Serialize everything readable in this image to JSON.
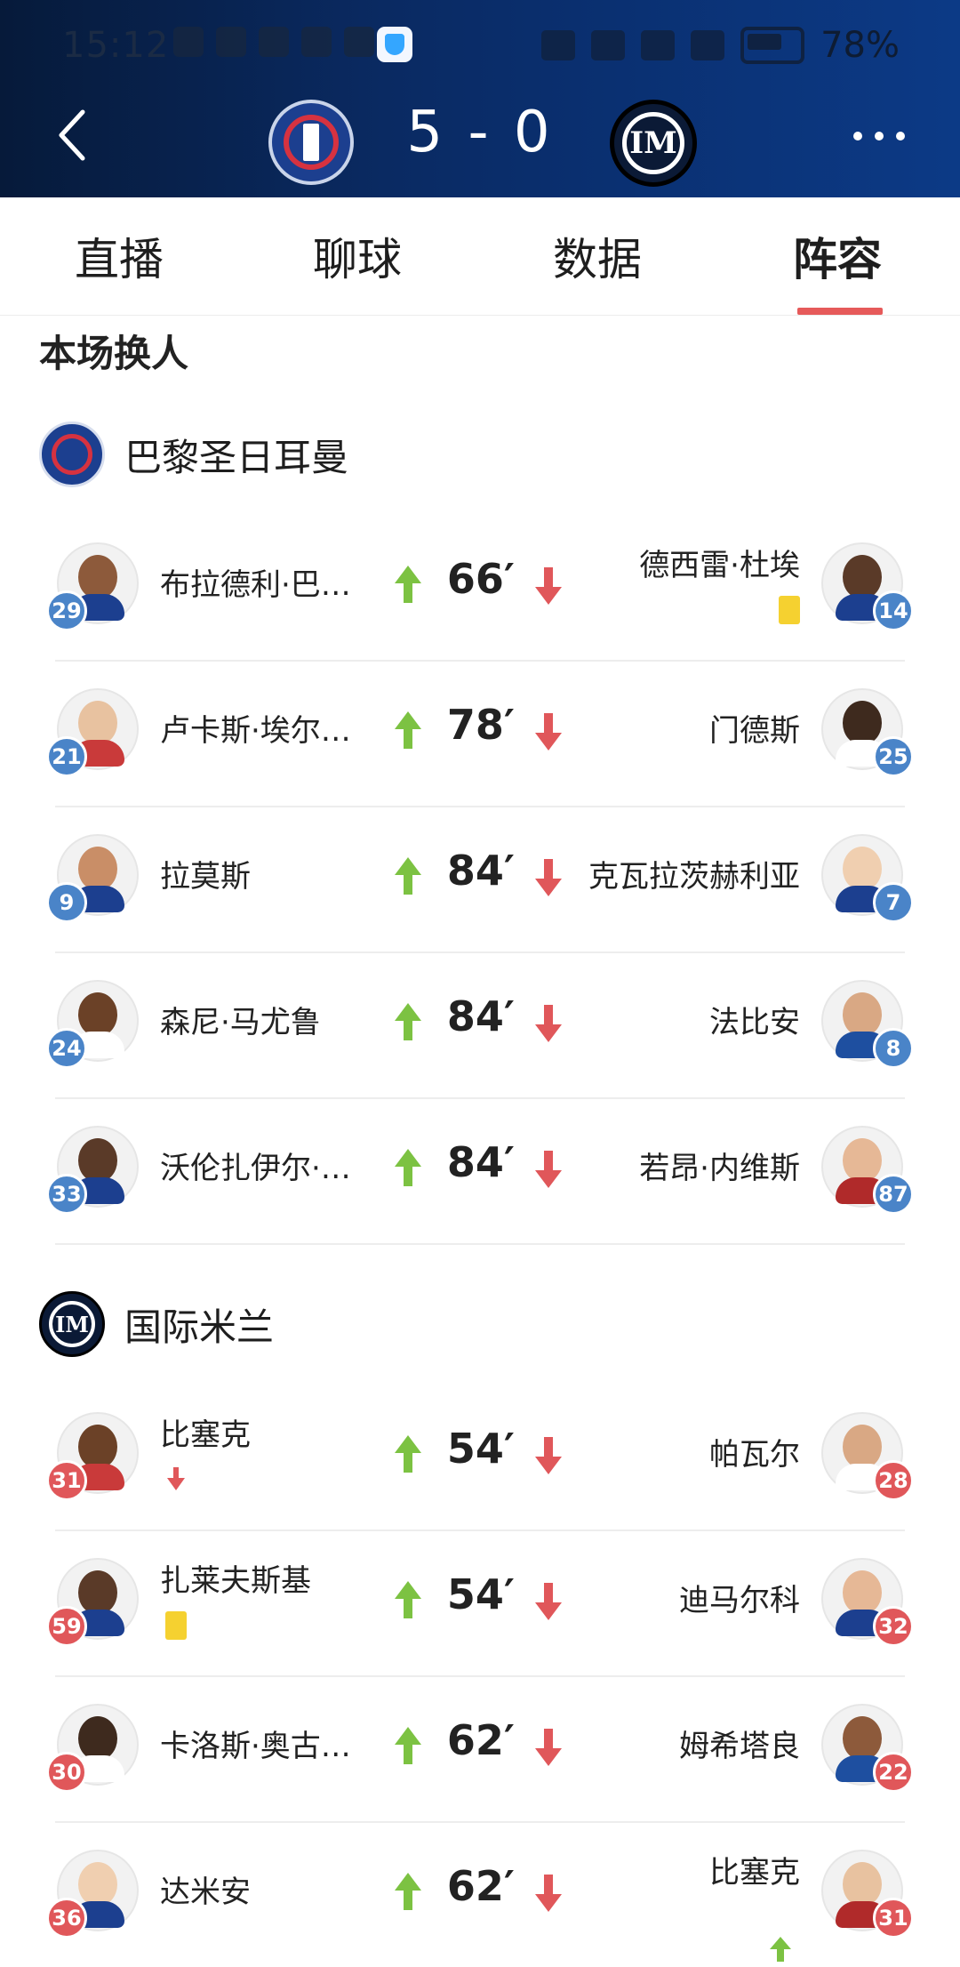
{
  "status_bar": {
    "time": "15:12",
    "battery": "78%"
  },
  "match": {
    "score": "5 - 0"
  },
  "tabs": [
    "直播",
    "聊球",
    "数据",
    "阵容"
  ],
  "active_tab": "阵容",
  "section_title": "本场换人",
  "teams": [
    {
      "name": "巴黎圣日耳曼",
      "badge_color": "#4a84c8",
      "subs": [
        {
          "in": "布拉德利·巴…",
          "in_no": "29",
          "minute": "66′",
          "out": "德西雷·杜埃",
          "out_no": "14",
          "out_card": true
        },
        {
          "in": "卢卡斯·埃尔…",
          "in_no": "21",
          "minute": "78′",
          "out": "门德斯",
          "out_no": "25"
        },
        {
          "in": "拉莫斯",
          "in_no": "9",
          "minute": "84′",
          "out": "克瓦拉茨赫利亚",
          "out_no": "7"
        },
        {
          "in": "森尼·马尤鲁",
          "in_no": "24",
          "minute": "84′",
          "out": "法比安",
          "out_no": "8"
        },
        {
          "in": "沃伦扎伊尔·…",
          "in_no": "33",
          "minute": "84′",
          "out": "若昂·内维斯",
          "out_no": "87"
        }
      ]
    },
    {
      "name": "国际米兰",
      "badge_color": "#e0575a",
      "subs": [
        {
          "in": "比塞克",
          "in_no": "31",
          "minute": "54′",
          "out": "帕瓦尔",
          "out_no": "28",
          "in_down_arrow": true
        },
        {
          "in": "扎莱夫斯基",
          "in_no": "59",
          "minute": "54′",
          "out": "迪马尔科",
          "out_no": "32",
          "in_card": true
        },
        {
          "in": "卡洛斯·奥古…",
          "in_no": "30",
          "minute": "62′",
          "out": "姆希塔良",
          "out_no": "22"
        },
        {
          "in": "达米安",
          "in_no": "36",
          "minute": "62′",
          "out": "比塞克",
          "out_no": "31",
          "out_up_arrow": true
        }
      ]
    }
  ],
  "colors": {
    "accent": "#e65a5a",
    "up": "#7cc242",
    "down": "#e0575a",
    "header": "#0a2a62"
  }
}
